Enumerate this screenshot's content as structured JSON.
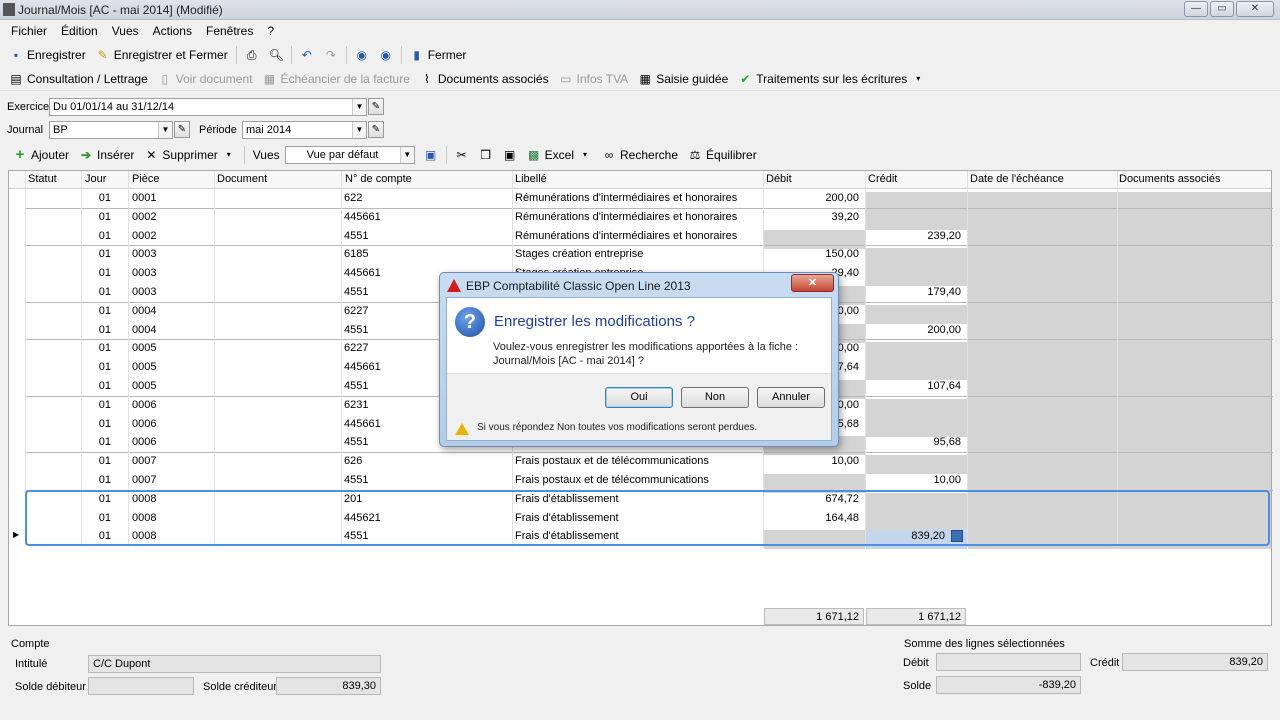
{
  "window": {
    "title": "Journal/Mois [AC - mai 2014] (Modifié)",
    "buttons": [
      "—",
      "▭",
      "✕"
    ]
  },
  "menu": [
    "Fichier",
    "Édition",
    "Vues",
    "Actions",
    "Fenêtres",
    "?"
  ],
  "toolbar1": {
    "save": "Enregistrer",
    "save_close": "Enregistrer et Fermer",
    "close": "Fermer"
  },
  "toolbar2": {
    "consult": "Consultation / Lettrage",
    "view_doc": "Voir document",
    "echeancier": "Échéancier de la facture",
    "docs": "Documents associés",
    "tva": "Infos TVA",
    "saisie": "Saisie guidée",
    "traitements": "Traitements sur les écritures"
  },
  "filters": {
    "exercice_label": "Exercice",
    "exercice_value": "Du 01/01/14 au 31/12/14",
    "journal_label": "Journal",
    "journal_value": "BP",
    "periode_label": "Période",
    "periode_value": "mai 2014"
  },
  "toolbar3": {
    "ajouter": "Ajouter",
    "inserer": "Insérer",
    "supprimer": "Supprimer",
    "vues": "Vues",
    "vue_value": "Vue par défaut",
    "excel": "Excel",
    "recherche": "Recherche",
    "equilibrer": "Équilibrer"
  },
  "columns": [
    "Statut",
    "Jour",
    "Pièce",
    "Document",
    "N° de compte",
    "Libellé",
    "Débit",
    "Crédit",
    "Date de l'échéance",
    "Documents associés"
  ],
  "rows": [
    {
      "jour": "01",
      "piece": "0001",
      "compte": "622",
      "libelle": "Rémunérations d'intermédiaires et honoraires",
      "debit": "200,00",
      "credit": ""
    },
    {
      "jour": "01",
      "piece": "0002",
      "compte": "445661",
      "libelle": "Rémunérations d'intermédiaires et honoraires",
      "debit": "39,20",
      "credit": ""
    },
    {
      "jour": "01",
      "piece": "0002",
      "compte": "4551",
      "libelle": "Rémunérations d'intermédiaires et honoraires",
      "debit": "",
      "credit": "239,20"
    },
    {
      "jour": "01",
      "piece": "0003",
      "compte": "6185",
      "libelle": "Stages création entreprise",
      "debit": "150,00",
      "credit": ""
    },
    {
      "jour": "01",
      "piece": "0003",
      "compte": "445661",
      "libelle": "Stages création entreprise",
      "debit": "29,40",
      "credit": ""
    },
    {
      "jour": "01",
      "piece": "0003",
      "compte": "4551",
      "libelle": "",
      "debit": "",
      "credit": "179,40"
    },
    {
      "jour": "01",
      "piece": "0004",
      "compte": "6227",
      "libelle": "",
      "debit": "200,00",
      "credit": ""
    },
    {
      "jour": "01",
      "piece": "0004",
      "compte": "4551",
      "libelle": "",
      "debit": "",
      "credit": "200,00"
    },
    {
      "jour": "01",
      "piece": "0005",
      "compte": "6227",
      "libelle": "",
      "debit": "100,00",
      "credit": ""
    },
    {
      "jour": "01",
      "piece": "0005",
      "compte": "445661",
      "libelle": "",
      "debit": "7,64",
      "credit": ""
    },
    {
      "jour": "01",
      "piece": "0005",
      "compte": "4551",
      "libelle": "",
      "debit": "",
      "credit": "107,64"
    },
    {
      "jour": "01",
      "piece": "0006",
      "compte": "6231",
      "libelle": "",
      "debit": "90,00",
      "credit": ""
    },
    {
      "jour": "01",
      "piece": "0006",
      "compte": "445661",
      "libelle": "",
      "debit": "5,68",
      "credit": ""
    },
    {
      "jour": "01",
      "piece": "0006",
      "compte": "4551",
      "libelle": "",
      "debit": "",
      "credit": "95,68"
    },
    {
      "jour": "01",
      "piece": "0007",
      "compte": "626",
      "libelle": "Frais postaux et de télécommunications",
      "debit": "10,00",
      "credit": ""
    },
    {
      "jour": "01",
      "piece": "0007",
      "compte": "4551",
      "libelle": "Frais postaux et de télécommunications",
      "debit": "",
      "credit": "10,00"
    },
    {
      "jour": "01",
      "piece": "0008",
      "compte": "201",
      "libelle": "Frais d'établissement",
      "debit": "674,72",
      "credit": ""
    },
    {
      "jour": "01",
      "piece": "0008",
      "compte": "445621",
      "libelle": "Frais d'établissement",
      "debit": "164,48",
      "credit": ""
    },
    {
      "jour": "01",
      "piece": "0008",
      "compte": "4551",
      "libelle": "Frais d'établissement",
      "debit": "",
      "credit": "839,20"
    }
  ],
  "totals": {
    "debit": "1 671,12",
    "credit": "1 671,12"
  },
  "compte": {
    "section": "Compte",
    "intitule_label": "Intitulé",
    "intitule_value": "C/C Dupont",
    "solde_deb_label": "Solde débiteur",
    "solde_deb_value": "",
    "solde_cred_label": "Solde créditeur",
    "solde_cred_value": "839,30"
  },
  "somme": {
    "section": "Somme des lignes sélectionnées",
    "debit_label": "Débit",
    "debit_value": "",
    "credit_label": "Crédit",
    "credit_value": "839,20",
    "solde_label": "Solde",
    "solde_value": "-839,20"
  },
  "dialog": {
    "title": "EBP Comptabilité Classic Open Line 2013",
    "heading": "Enregistrer les modifications ?",
    "message_line1": "Voulez-vous enregistrer les modifications apportées à la fiche :",
    "message_line2": "Journal/Mois [AC - mai 2014]  ?",
    "btn_yes": "Oui",
    "btn_no": "Non",
    "btn_cancel": "Annuler",
    "warning": "Si vous répondez Non toutes vos modifications seront perdues."
  }
}
